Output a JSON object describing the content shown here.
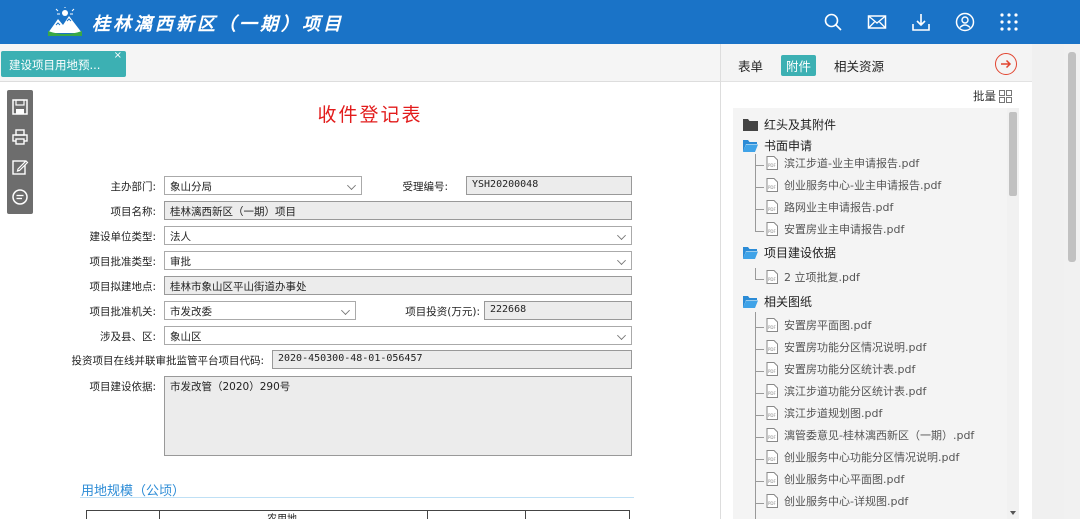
{
  "header": {
    "title": "桂林漓西新区（一期）项目",
    "icons": [
      "search-icon",
      "mail-icon",
      "download-icon",
      "user-icon",
      "apps-grid-icon"
    ]
  },
  "tabbar": {
    "tab_label": "建设项目用地预...",
    "close": "×"
  },
  "form": {
    "title": "收件登记表",
    "fields": {
      "dept_label": "主办部门:",
      "dept_value": "象山分局",
      "accept_no_label": "受理编号:",
      "accept_no_value": "YSH20200048",
      "project_name_label": "项目名称:",
      "project_name_value": "桂林漓西新区（一期）项目",
      "unit_type_label": "建设单位类型:",
      "unit_type_value": "法人",
      "approval_type_label": "项目批准类型:",
      "approval_type_value": "审批",
      "location_label": "项目拟建地点:",
      "location_value": "桂林市象山区平山街道办事处",
      "approval_org_label": "项目批准机关:",
      "approval_org_value": "市发改委",
      "investment_label": "项目投资(万元):",
      "investment_value": "222668",
      "county_label": "涉及县、区:",
      "county_value": "象山区",
      "platform_code_label": "投资项目在线并联审批监管平台项目代码:",
      "platform_code_value": "2020-450300-48-01-056457",
      "basis_label": "项目建设依据:",
      "basis_value": "市发改管（2020）290号"
    },
    "section_title": "用地规模（公顷）",
    "table_header_partial": "农用地"
  },
  "right_panel": {
    "tabs": [
      "表单",
      "附件",
      "相关资源"
    ],
    "active_tab": "附件",
    "batch_label": "批量",
    "tree": [
      {
        "folder": "红头及其附件",
        "files": []
      },
      {
        "folder": "书面申请",
        "files": [
          "滨江步道-业主申请报告.pdf",
          "创业服务中心-业主申请报告.pdf",
          "路网业主申请报告.pdf",
          "安置房业主申请报告.pdf"
        ]
      },
      {
        "folder": "项目建设依据",
        "files": [
          "2 立项批复.pdf"
        ]
      },
      {
        "folder": "相关图纸",
        "files": [
          "安置房平面图.pdf",
          "安置房功能分区情况说明.pdf",
          "安置房功能分区统计表.pdf",
          "滨江步道功能分区统计表.pdf",
          "滨江步道规划图.pdf",
          "漓管委意见-桂林漓西新区（一期）.pdf",
          "创业服务中心功能分区情况说明.pdf",
          "创业服务中心平面图.pdf",
          "创业服务中心-详规图.pdf"
        ]
      }
    ]
  },
  "colors": {
    "header_bg": "#1a73c7",
    "accent_teal": "#3cb0b3",
    "title_red": "#e21c1c",
    "section_blue": "#2b8bd6"
  }
}
